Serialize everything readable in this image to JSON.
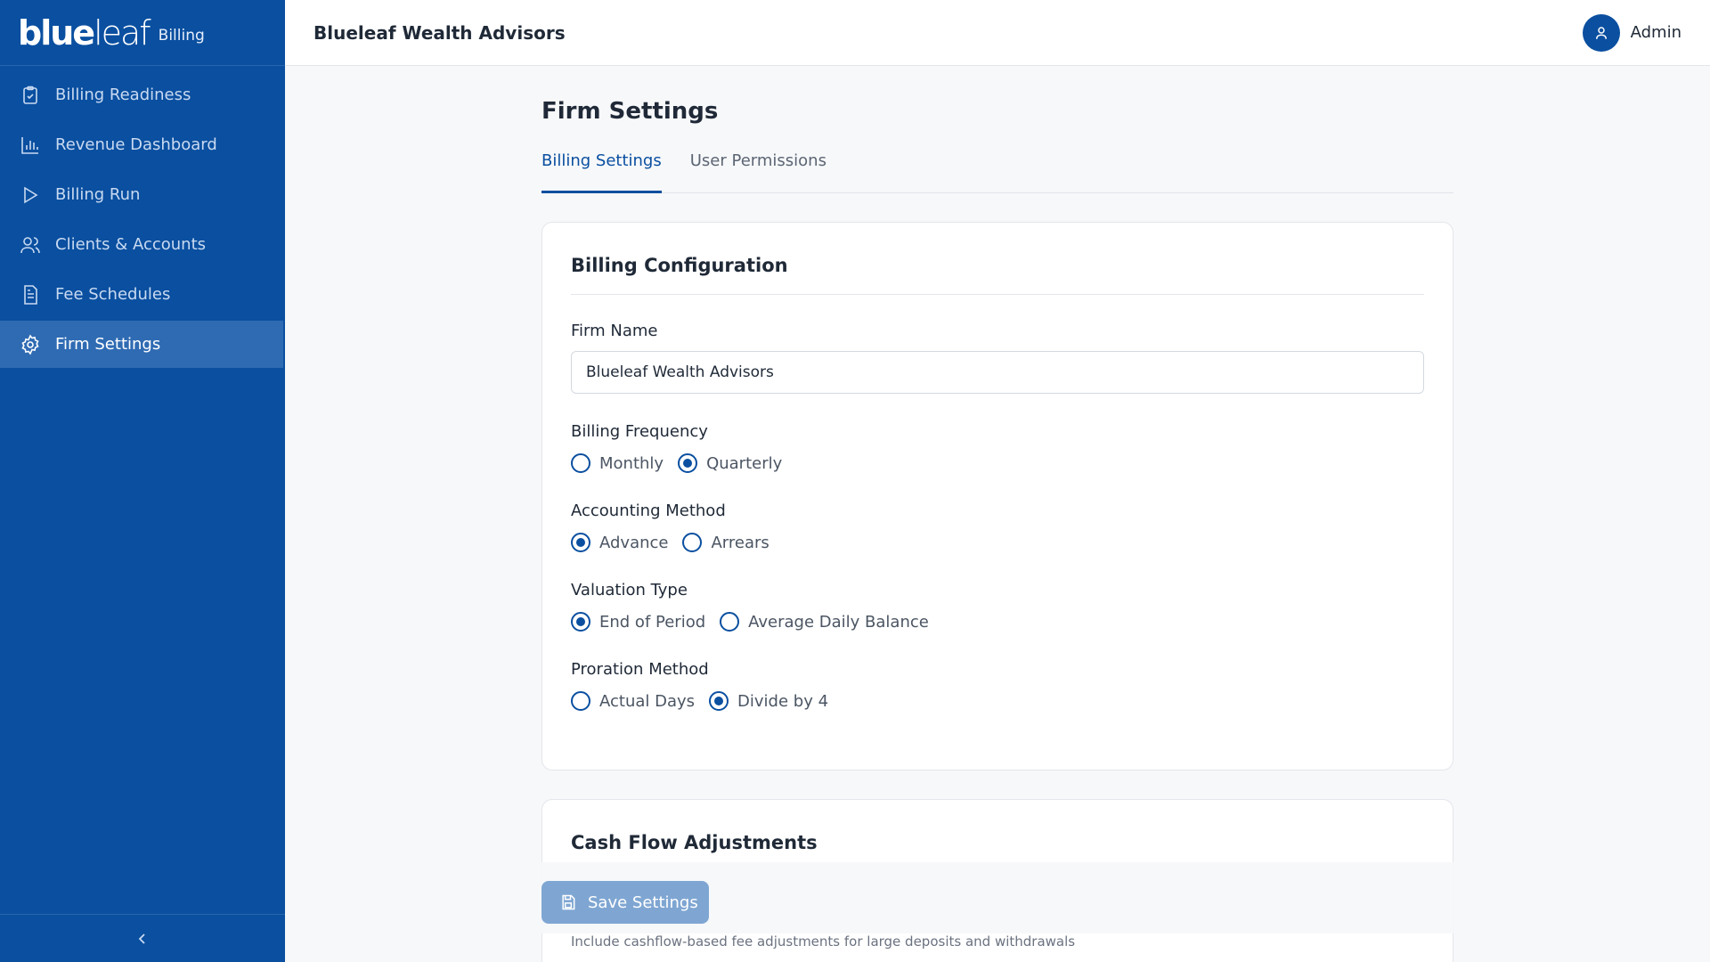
{
  "brand": {
    "logo_bold": "blue",
    "logo_light": "leaf",
    "product": "Billing"
  },
  "sidebar": {
    "items": [
      {
        "label": "Billing Readiness",
        "icon": "clipboard-check-icon"
      },
      {
        "label": "Revenue Dashboard",
        "icon": "bar-chart-icon"
      },
      {
        "label": "Billing Run",
        "icon": "play-icon"
      },
      {
        "label": "Clients & Accounts",
        "icon": "users-icon"
      },
      {
        "label": "Fee Schedules",
        "icon": "document-icon"
      },
      {
        "label": "Firm Settings",
        "icon": "gear-icon",
        "active": true
      }
    ]
  },
  "header": {
    "title": "Blueleaf Wealth Advisors",
    "user": "Admin"
  },
  "page": {
    "title": "Firm Settings",
    "tabs": [
      {
        "label": "Billing Settings",
        "active": true
      },
      {
        "label": "User Permissions"
      }
    ]
  },
  "billing_config": {
    "title": "Billing Configuration",
    "firm_name_label": "Firm Name",
    "firm_name_value": "Blueleaf Wealth Advisors",
    "frequency": {
      "label": "Billing Frequency",
      "options": [
        "Monthly",
        "Quarterly"
      ],
      "selected": "Quarterly"
    },
    "accounting": {
      "label": "Accounting Method",
      "options": [
        "Advance",
        "Arrears"
      ],
      "selected": "Advance"
    },
    "valuation": {
      "label": "Valuation Type",
      "options": [
        "End of Period",
        "Average Daily Balance"
      ],
      "selected": "End of Period"
    },
    "proration": {
      "label": "Proration Method",
      "options": [
        "Actual Days",
        "Divide by 4"
      ],
      "selected": "Divide by 4"
    }
  },
  "cash_flow": {
    "title": "Cash Flow Adjustments",
    "hint": "Include cashflow-based fee adjustments for large deposits and withdrawals"
  },
  "save_label": "Save Settings",
  "colors": {
    "primary": "#0a4fa0",
    "sidebar_active": "#2f6bb3",
    "save_disabled": "#7fa6d2"
  }
}
